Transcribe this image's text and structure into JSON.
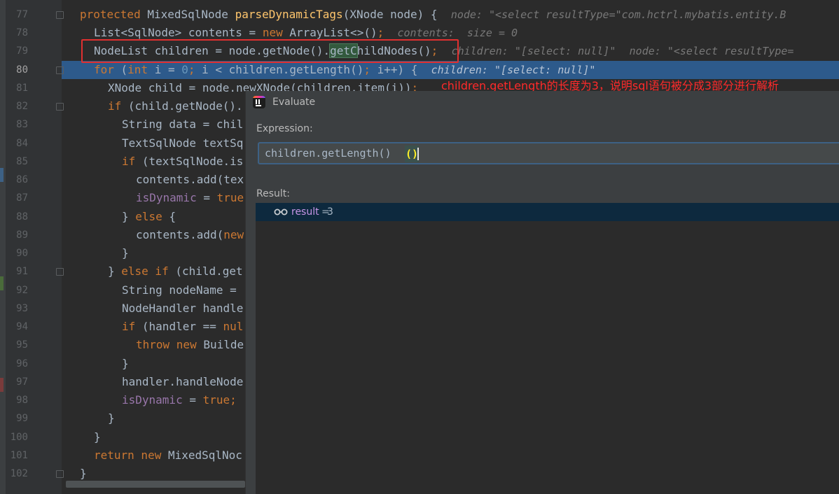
{
  "editor": {
    "line_numbers": [
      "77",
      "78",
      "79",
      "80",
      "81",
      "82",
      "83",
      "84",
      "85",
      "86",
      "87",
      "88",
      "89",
      "90",
      "91",
      "92",
      "93",
      "94",
      "95",
      "96",
      "97",
      "98",
      "99",
      "100",
      "101",
      "102"
    ],
    "current_line": "80",
    "hints": {
      "l77": "node: \"<select resultType=\"com.hctrl.mybatis.entity.B",
      "l78": "contents:  size = 0",
      "l79a": "children: \"[select: null]\"",
      "l79b": "node: \"<select resultType=",
      "l80": "children: \"[select: null]\""
    },
    "annotation": "children.getLength的长度为3，说明sql语句被分成3部分进行解析"
  },
  "evaluate": {
    "title": "Evaluate",
    "expression_label": "Expression:",
    "expression": "children.getLength()",
    "result_label": "Result:",
    "result_name": "result",
    "result_eq": "=",
    "result_value": "3"
  },
  "colors": {
    "keyword": "#cc7832",
    "method": "#ffc66d",
    "number": "#6897bb",
    "field": "#9876aa",
    "text": "#a9b7c6",
    "background": "#2b2b2b",
    "current_line": "#2d5a8b",
    "annotation": "#ff2a2a"
  }
}
